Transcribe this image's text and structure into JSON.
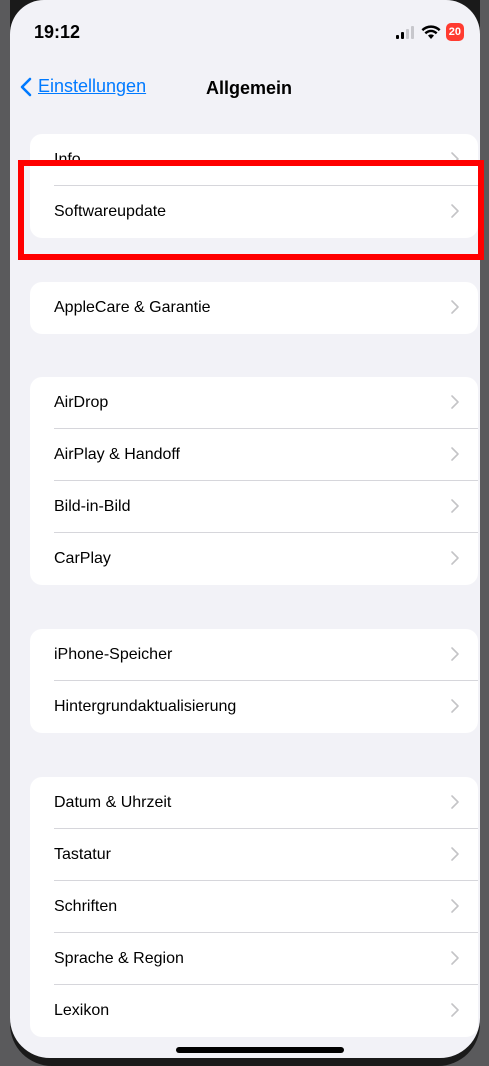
{
  "status": {
    "time": "19:12",
    "battery": "20"
  },
  "nav": {
    "back_label": "Einstellungen",
    "title": "Allgemein"
  },
  "groups": [
    {
      "items": [
        {
          "label": "Info"
        },
        {
          "label": "Softwareupdate"
        }
      ]
    },
    {
      "items": [
        {
          "label": "AppleCare & Garantie"
        }
      ]
    },
    {
      "items": [
        {
          "label": "AirDrop"
        },
        {
          "label": "AirPlay & Handoff"
        },
        {
          "label": "Bild-in-Bild"
        },
        {
          "label": "CarPlay"
        }
      ]
    },
    {
      "items": [
        {
          "label": "iPhone-Speicher"
        },
        {
          "label": "Hintergrundaktualisierung"
        }
      ]
    },
    {
      "items": [
        {
          "label": "Datum & Uhrzeit"
        },
        {
          "label": "Tastatur"
        },
        {
          "label": "Schriften"
        },
        {
          "label": "Sprache & Region"
        },
        {
          "label": "Lexikon"
        }
      ]
    }
  ],
  "colors": {
    "accent": "#007aff",
    "highlight": "#ff0000",
    "background": "#f2f2f7",
    "battery": "#ff3b30"
  }
}
